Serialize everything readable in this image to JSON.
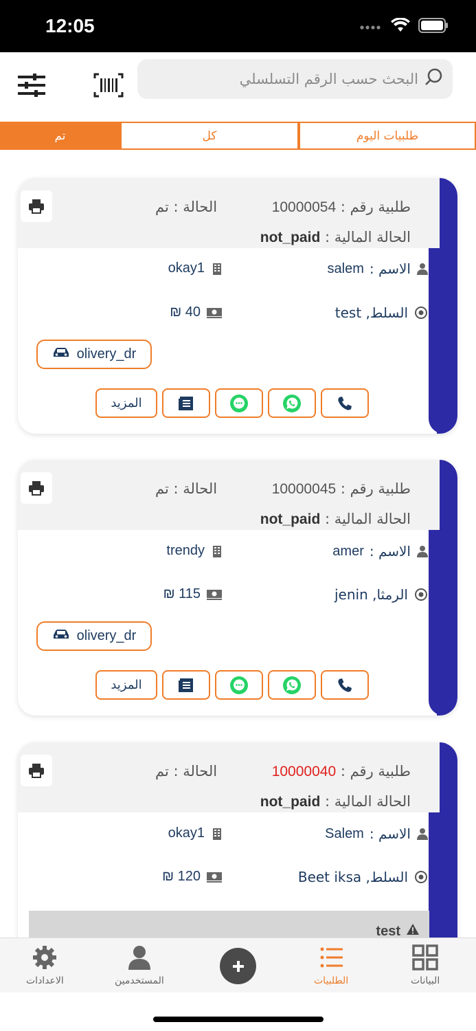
{
  "status_bar": {
    "time": "12:05"
  },
  "search": {
    "placeholder": "البحث حسب الرقم التسلسلي"
  },
  "tabs": [
    {
      "label": "طلبيات اليوم",
      "active": false
    },
    {
      "label": "كل",
      "active": false
    },
    {
      "label": "تم",
      "active": true
    }
  ],
  "labels": {
    "order_prefix": "طلبية رقم : ",
    "status": "الحالة : تم",
    "financial_prefix": "الحالة المالية : ",
    "name_prefix": "الاسم : ",
    "more": "المزيد"
  },
  "orders": [
    {
      "number": "10000054",
      "number_red": false,
      "financial_status": "not_paid",
      "customer_name": "salem",
      "store": "okay1",
      "price": "40 ₪",
      "location": "السلط, test",
      "driver": "olivery_dr"
    },
    {
      "number": "10000045",
      "number_red": false,
      "financial_status": "not_paid",
      "customer_name": "amer",
      "store": "trendy",
      "price": "115 ₪",
      "location": "الرمثا, jenin",
      "driver": "olivery_dr"
    },
    {
      "number": "10000040",
      "number_red": true,
      "financial_status": "not_paid",
      "customer_name": "Salem",
      "store": "okay1",
      "price": "120 ₪",
      "location": "السلط, Beet iksa",
      "note": "test"
    }
  ],
  "bottom_nav": {
    "settings": "الاعدادات",
    "users": "المستخدمين",
    "orders": "الطلبيات",
    "data": "البيانات"
  },
  "colors": {
    "accent": "#f07d2a",
    "card_stripe": "#2d2aa6",
    "whatsapp": "#25d366",
    "red_number": "#e0221e"
  }
}
